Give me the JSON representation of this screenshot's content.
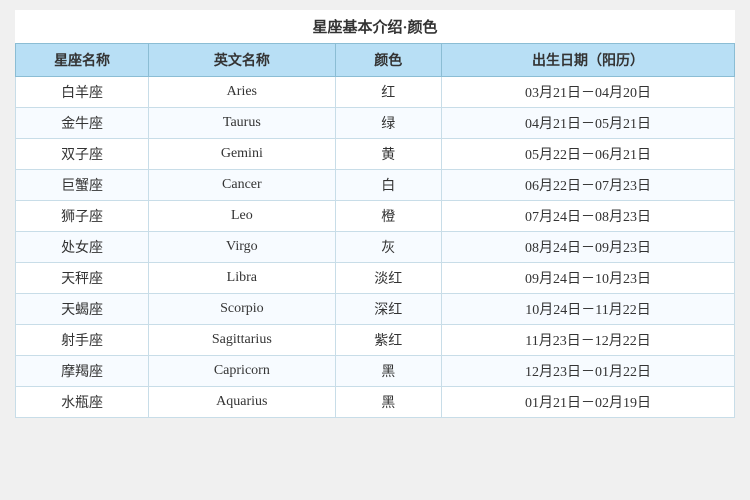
{
  "title": "星座基本介绍·颜色",
  "headers": [
    "星座名称",
    "英文名称",
    "颜色",
    "出生日期（阳历）"
  ],
  "rows": [
    {
      "zh": "白羊座",
      "en": "Aries",
      "color": "红",
      "date": "03月21日－04月20日"
    },
    {
      "zh": "金牛座",
      "en": "Taurus",
      "color": "绿",
      "date": "04月21日－05月21日"
    },
    {
      "zh": "双子座",
      "en": "Gemini",
      "color": "黄",
      "date": "05月22日－06月21日"
    },
    {
      "zh": "巨蟹座",
      "en": "Cancer",
      "color": "白",
      "date": "06月22日－07月23日"
    },
    {
      "zh": "狮子座",
      "en": "Leo",
      "color": "橙",
      "date": "07月24日－08月23日"
    },
    {
      "zh": "处女座",
      "en": "Virgo",
      "color": "灰",
      "date": "08月24日－09月23日"
    },
    {
      "zh": "天秤座",
      "en": "Libra",
      "color": "淡红",
      "date": "09月24日－10月23日"
    },
    {
      "zh": "天蝎座",
      "en": "Scorpio",
      "color": "深红",
      "date": "10月24日－11月22日"
    },
    {
      "zh": "射手座",
      "en": "Sagittarius",
      "color": "紫红",
      "date": "11月23日－12月22日"
    },
    {
      "zh": "摩羯座",
      "en": "Capricorn",
      "color": "黑",
      "date": "12月23日－01月22日"
    },
    {
      "zh": "水瓶座",
      "en": "Aquarius",
      "color": "黑",
      "date": "01月21日－02月19日"
    }
  ]
}
